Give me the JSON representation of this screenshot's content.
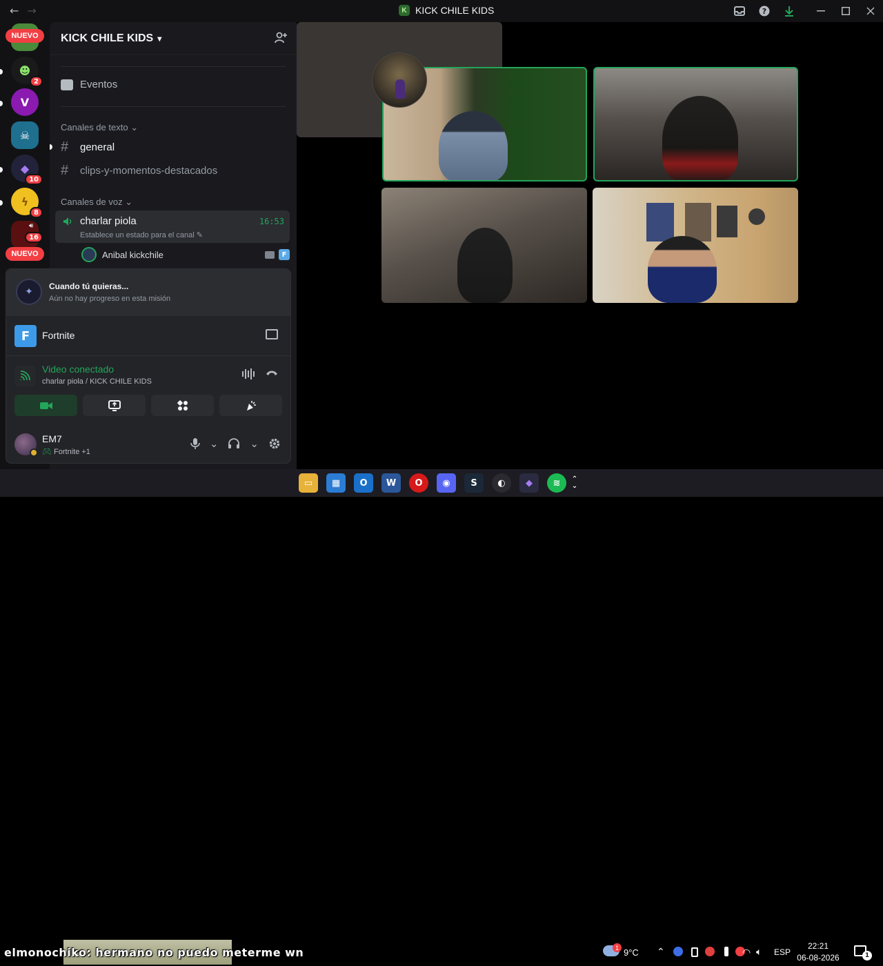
{
  "window": {
    "title": "KICK CHILE KIDS",
    "back_icon": "←",
    "forward_icon": "→"
  },
  "rail": {
    "new_label": "NUEVO",
    "servers": [
      {
        "badge": "2"
      },
      {
        "badge": ""
      },
      {
        "badge": ""
      },
      {
        "badge": "10"
      },
      {
        "badge": "8"
      },
      {
        "badge": "16"
      }
    ],
    "new_label_2": "NUEVO"
  },
  "guild": {
    "name": "KICK CHILE KIDS",
    "events_label": "Eventos",
    "text_category": "Canales de texto",
    "text_channels": [
      "general",
      "clips-y-momentos-destacados"
    ],
    "voice_category": "Canales de voz",
    "voice_channel": {
      "name": "charlar piola",
      "time": "16:53",
      "status_placeholder": "Establece un estado para el canal",
      "member": "Anibal kickchile"
    }
  },
  "quest": {
    "title": "Cuando tú quieras...",
    "subtitle": "Aún no hay progreso en esta misión"
  },
  "activity": {
    "game": "Fortnite"
  },
  "connection": {
    "title": "Video conectado",
    "subtitle": "charlar piola / KICK CHILE KIDS"
  },
  "user": {
    "name": "EM7",
    "status": "Fortnite +1"
  },
  "taskbar": {
    "caption": "elmonochiko: hermano no puedo meterme wn",
    "weather_badge": "1",
    "temperature": "9°C",
    "language": "ESP",
    "time": "22:21",
    "date": "06-08-2026",
    "notifications": "1"
  },
  "colors": {
    "speaking": "#23a55a",
    "badge": "#f23f43"
  }
}
